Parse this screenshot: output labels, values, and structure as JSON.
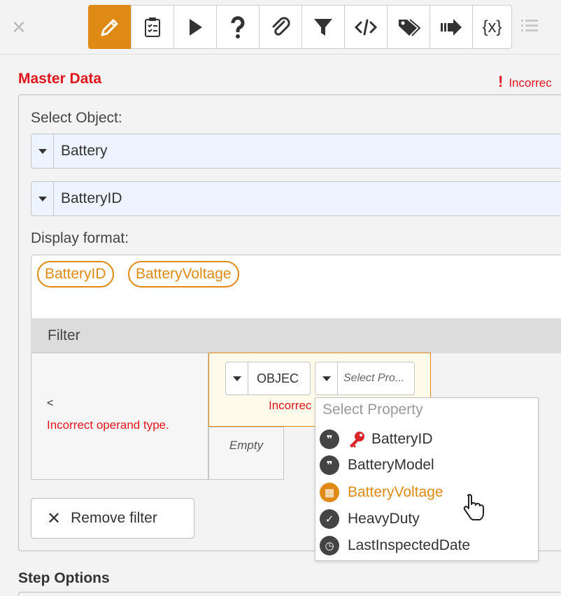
{
  "toolbar": {
    "tools": [
      {
        "icon": "pencil-icon",
        "active": true
      },
      {
        "icon": "clipboard-checklist-icon"
      },
      {
        "icon": "play-icon"
      },
      {
        "icon": "question-icon"
      },
      {
        "icon": "paperclip-icon"
      },
      {
        "icon": "filter-icon"
      },
      {
        "icon": "code-icon"
      },
      {
        "icon": "tags-icon"
      },
      {
        "icon": "arrow-right-icon"
      },
      {
        "icon": "variable-icon",
        "text": "{x}"
      }
    ],
    "accent": "#e08a16"
  },
  "master": {
    "title": "Master Data",
    "error": "Incorrec",
    "select_object_label": "Select Object:",
    "object_value": "Battery",
    "property_value": "BatteryID",
    "display_format_label": "Display format:",
    "tags": [
      "BatteryID",
      "BatteryVoltage"
    ]
  },
  "filter": {
    "title": "Filter",
    "operator": "<",
    "operand_error": "Incorrect operand type.",
    "object_select": "OBJEC",
    "property_placeholder": "Select Pro...",
    "mid_error": "Incorrec",
    "empty": "Empty",
    "remove_label": "Remove filter"
  },
  "dropdown": {
    "header": "Select Property",
    "items": [
      {
        "label": "BatteryID",
        "icon": "quote-icon",
        "key": true
      },
      {
        "label": "BatteryModel",
        "icon": "quote-icon"
      },
      {
        "label": "BatteryVoltage",
        "icon": "calculator-icon",
        "hover": true
      },
      {
        "label": "HeavyDuty",
        "icon": "boolean-icon"
      },
      {
        "label": "LastInspectedDate",
        "icon": "clock-icon"
      }
    ]
  },
  "step": {
    "title": "Step Options"
  },
  "colors": {
    "error": "#e0151c",
    "accent": "#e08a16"
  }
}
